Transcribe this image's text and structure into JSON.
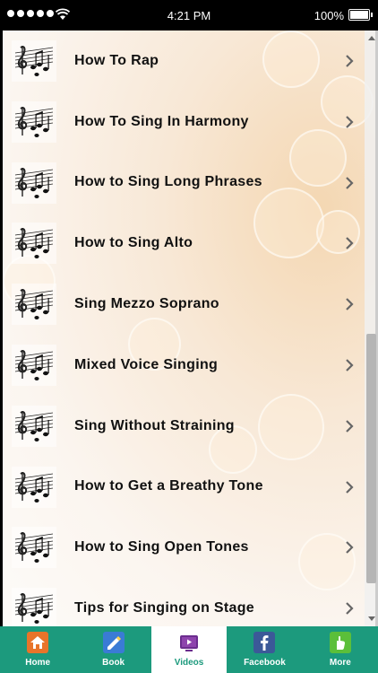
{
  "status_bar": {
    "time": "4:21 PM",
    "battery": "100%"
  },
  "list": {
    "items": [
      {
        "label": "How To Rap"
      },
      {
        "label": "How To Sing In Harmony"
      },
      {
        "label": "How to Sing Long Phrases"
      },
      {
        "label": "How to Sing Alto"
      },
      {
        "label": "Sing Mezzo Soprano"
      },
      {
        "label": "Mixed Voice Singing"
      },
      {
        "label": "Sing Without Straining"
      },
      {
        "label": "How to Get a Breathy Tone"
      },
      {
        "label": "How to Sing Open Tones"
      },
      {
        "label": "Tips for Singing on Stage"
      }
    ]
  },
  "tabbar": {
    "tabs": [
      {
        "label": "Home",
        "icon": "home-icon",
        "color": "#e8742a"
      },
      {
        "label": "Book",
        "icon": "book-icon",
        "color": "#3a7bd5"
      },
      {
        "label": "Videos",
        "icon": "video-icon",
        "color": "#6b2d8e"
      },
      {
        "label": "Facebook",
        "icon": "facebook-icon",
        "color": "#3b5998"
      },
      {
        "label": "More",
        "icon": "more-icon",
        "color": "#5bbf3a"
      }
    ],
    "active": "Videos",
    "background": "#1c9a7d"
  }
}
